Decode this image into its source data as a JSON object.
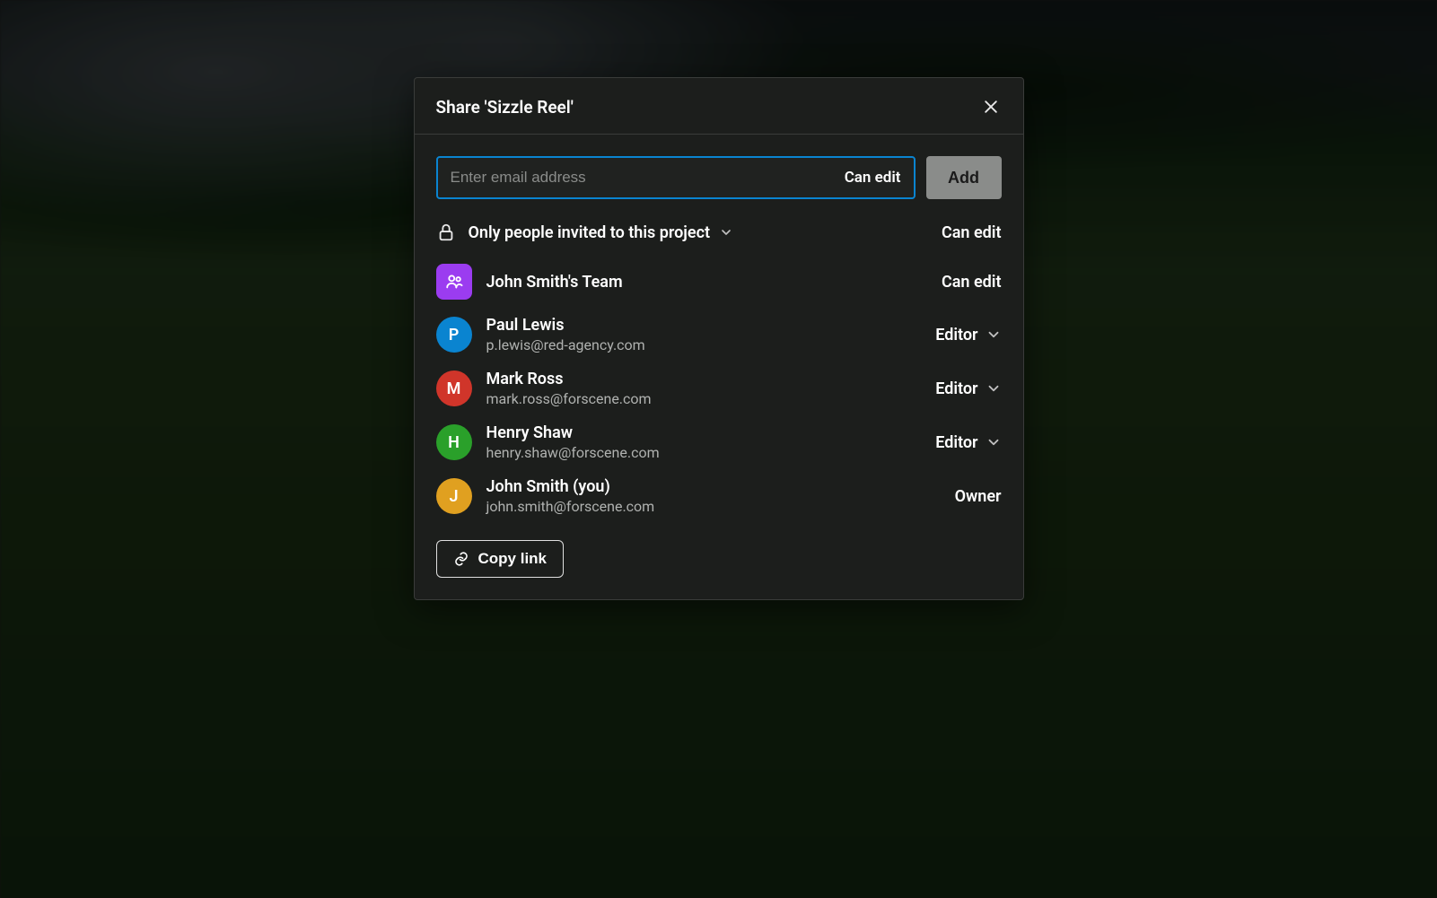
{
  "modal": {
    "title": "Share 'Sizzle Reel'",
    "email_placeholder": "Enter email address",
    "inline_permission": "Can edit",
    "add_label": "Add",
    "access": {
      "label": "Only people invited to this project",
      "permission": "Can edit"
    },
    "team": {
      "name": "John Smith's Team",
      "permission": "Can edit",
      "avatar_color": "#9b3cf0"
    },
    "members": [
      {
        "initial": "P",
        "color": "#0a84d0",
        "name": "Paul Lewis",
        "email": "p.lewis@red-agency.com",
        "role": "Editor",
        "role_mutable": true
      },
      {
        "initial": "M",
        "color": "#d0352a",
        "name": "Mark Ross",
        "email": "mark.ross@forscene.com",
        "role": "Editor",
        "role_mutable": true
      },
      {
        "initial": "H",
        "color": "#2aa02a",
        "name": "Henry Shaw",
        "email": "henry.shaw@forscene.com",
        "role": "Editor",
        "role_mutable": true
      },
      {
        "initial": "J",
        "color": "#e0a020",
        "name": "John Smith (you)",
        "email": "john.smith@forscene.com",
        "role": "Owner",
        "role_mutable": false
      }
    ],
    "copy_link_label": "Copy link"
  }
}
